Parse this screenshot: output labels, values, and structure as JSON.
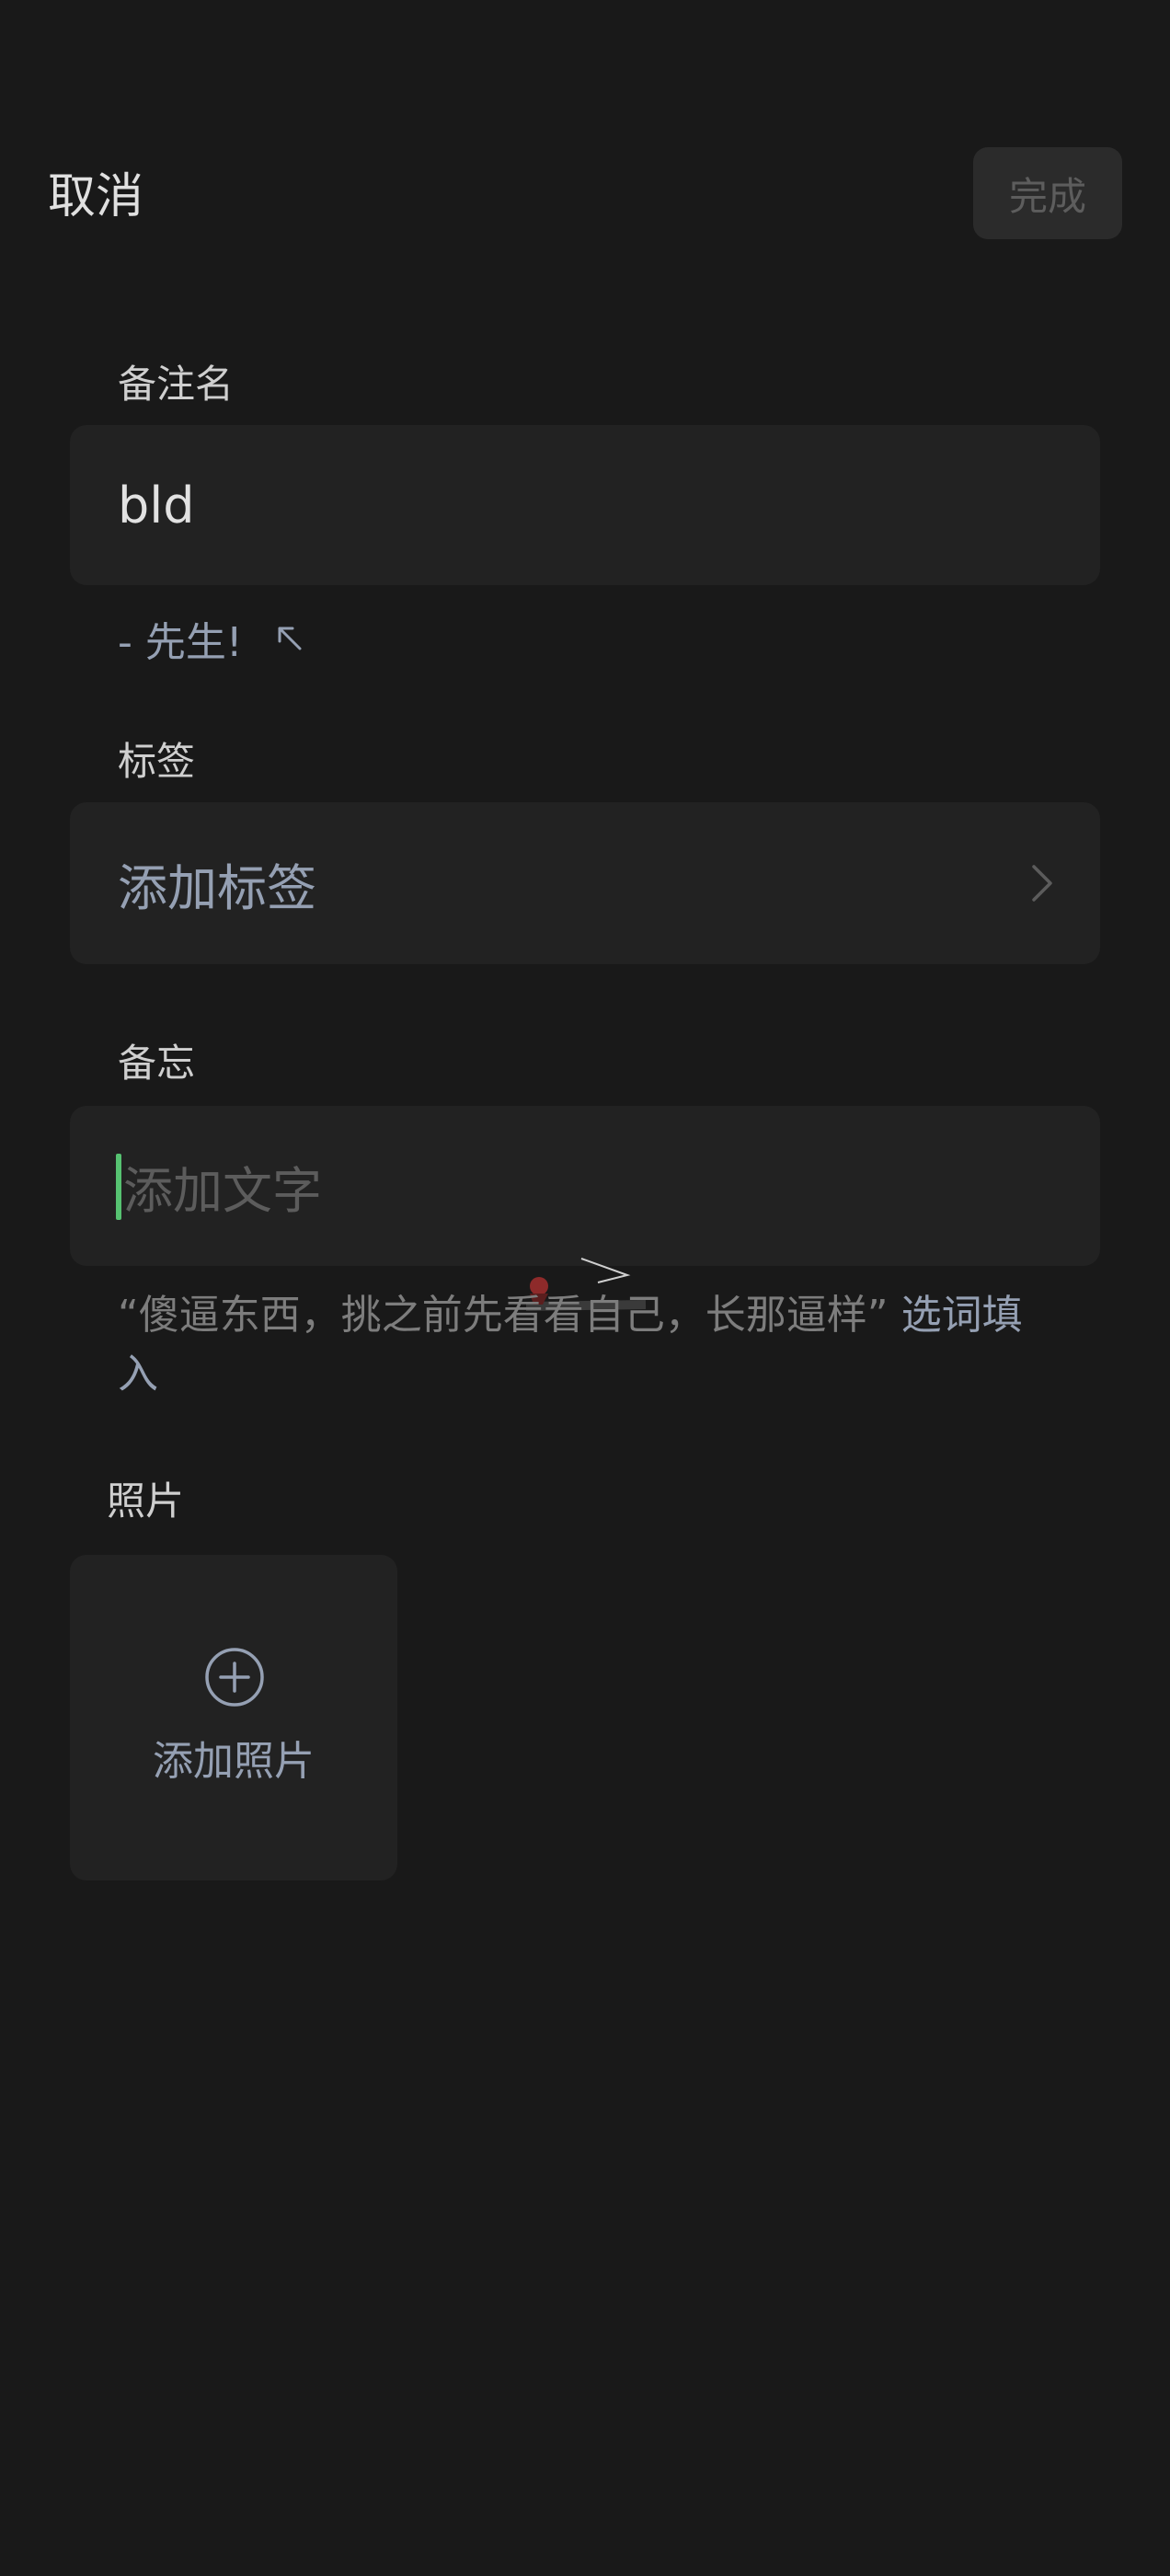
{
  "topbar": {
    "cancel_label": "取消",
    "done_label": "完成"
  },
  "remark": {
    "label": "备注名",
    "value": "bld",
    "suggestion": "- 先生!"
  },
  "tags": {
    "label": "标签",
    "placeholder": "添加标签"
  },
  "memo": {
    "label": "备忘",
    "placeholder": "添加文字",
    "clipboard_quote": "“傻逼东西，挑之前先看看自己，长那逼样”",
    "pick_words_link": "选词填入"
  },
  "photos": {
    "label": "照片",
    "add_label": "添加照片"
  },
  "colors": {
    "background": "#191919",
    "field": "#222222",
    "accent_link": "#95a0b3",
    "cursor": "#56c271"
  }
}
